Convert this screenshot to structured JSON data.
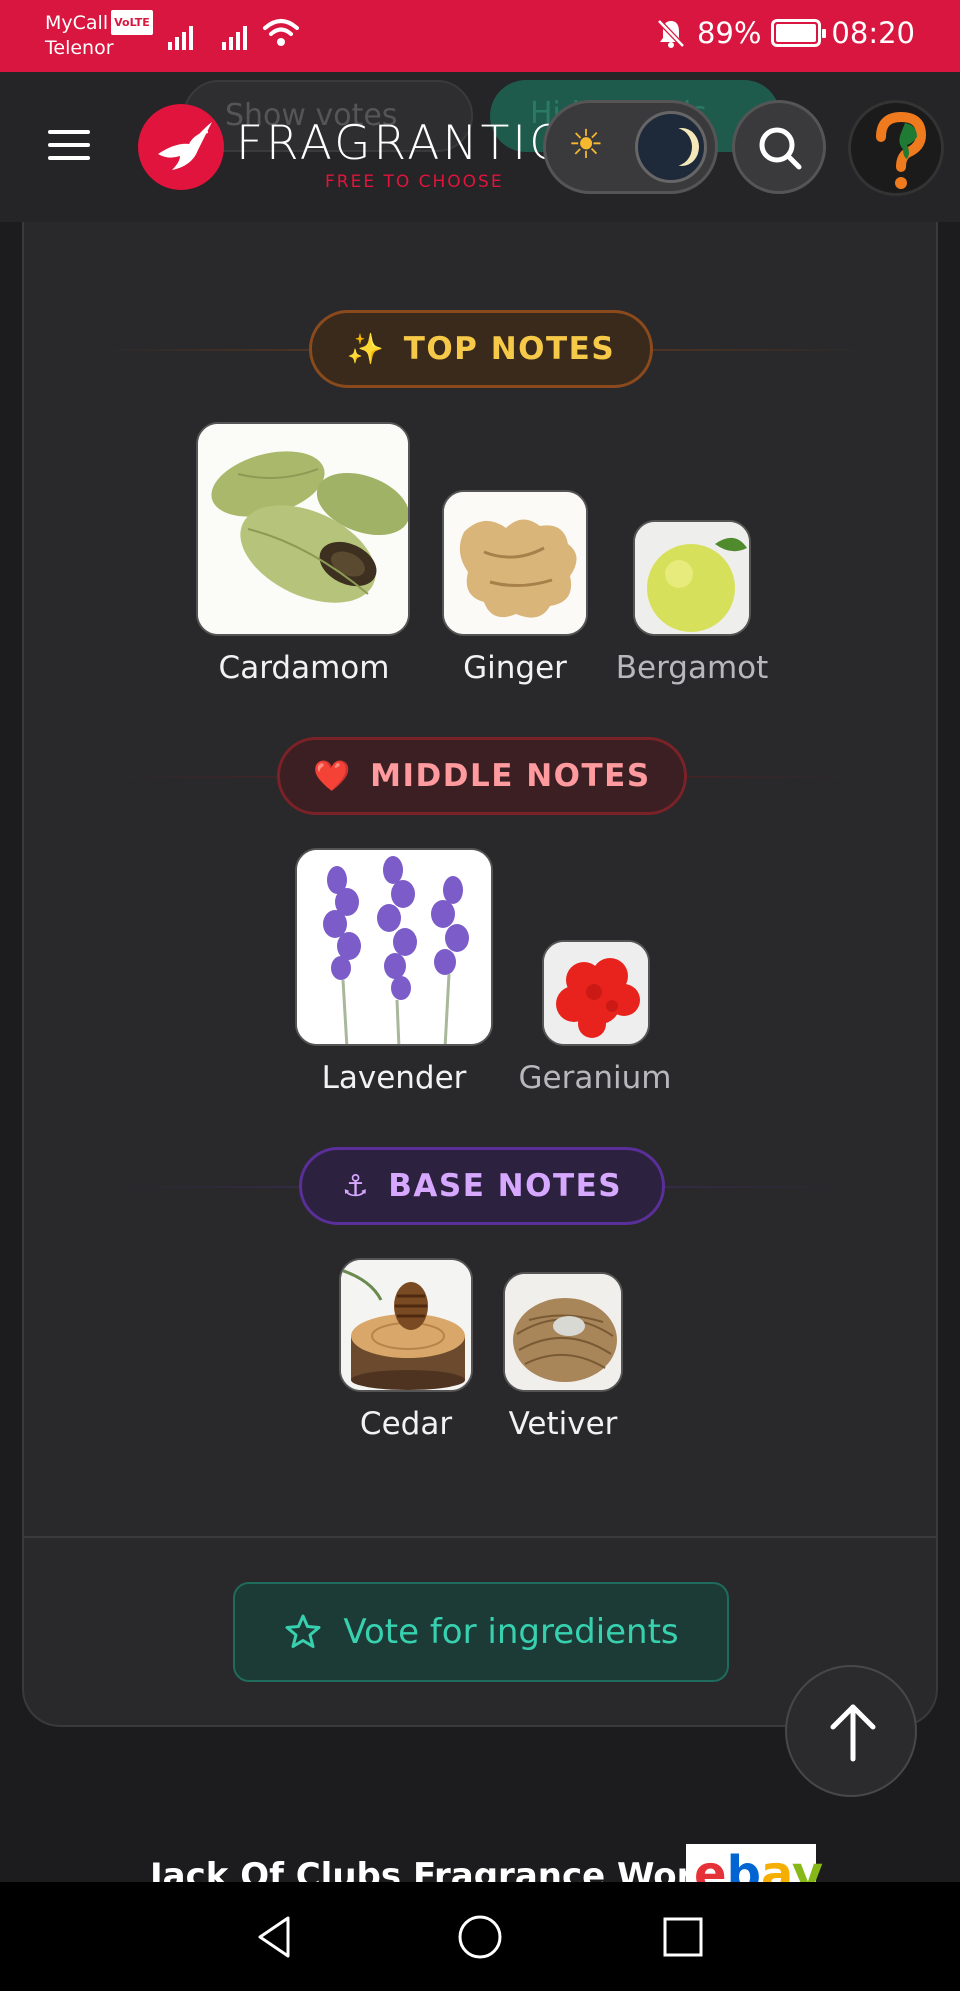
{
  "status_bar": {
    "carrier_line1": "MyCall",
    "volte": "VoLTE",
    "carrier_line2": "Telenor",
    "battery": "89%",
    "battery_level": 0.89,
    "time": "08:20"
  },
  "header": {
    "behind_votes_label": "Show votes",
    "behind_hide_label": "Hide panels",
    "logo_word": "FRAGRANTICA",
    "logo_tagline": "FREE TO CHOOSE"
  },
  "sections": {
    "top": {
      "emoji": "✨",
      "title": "TOP NOTES",
      "notes": [
        {
          "name": "Cardamom"
        },
        {
          "name": "Ginger"
        },
        {
          "name": "Bergamot"
        }
      ]
    },
    "middle": {
      "emoji": "❤️",
      "title": "MIDDLE NOTES",
      "notes": [
        {
          "name": "Lavender"
        },
        {
          "name": "Geranium"
        }
      ]
    },
    "base": {
      "emoji": "⚓",
      "title": "BASE NOTES",
      "notes": [
        {
          "name": "Cedar"
        },
        {
          "name": "Vetiver"
        }
      ]
    }
  },
  "vote_button": {
    "label": "Vote for ingredients"
  },
  "ad": {
    "text": "Jack Of Clubs Fragrance World",
    "logo": "ebay"
  },
  "colors": {
    "status_bar": "#d9163f",
    "brand_red": "#e0143c",
    "top_accent": "#f7c948",
    "middle_accent": "#ff9a9e",
    "base_accent": "#d7a8ff",
    "vote_accent": "#38d1b0"
  },
  "icons": [
    "menu-icon",
    "sun-icon",
    "moon-icon",
    "search-icon",
    "help-icon",
    "star-icon",
    "arrow-up-icon",
    "back-icon",
    "home-icon",
    "recents-icon"
  ]
}
